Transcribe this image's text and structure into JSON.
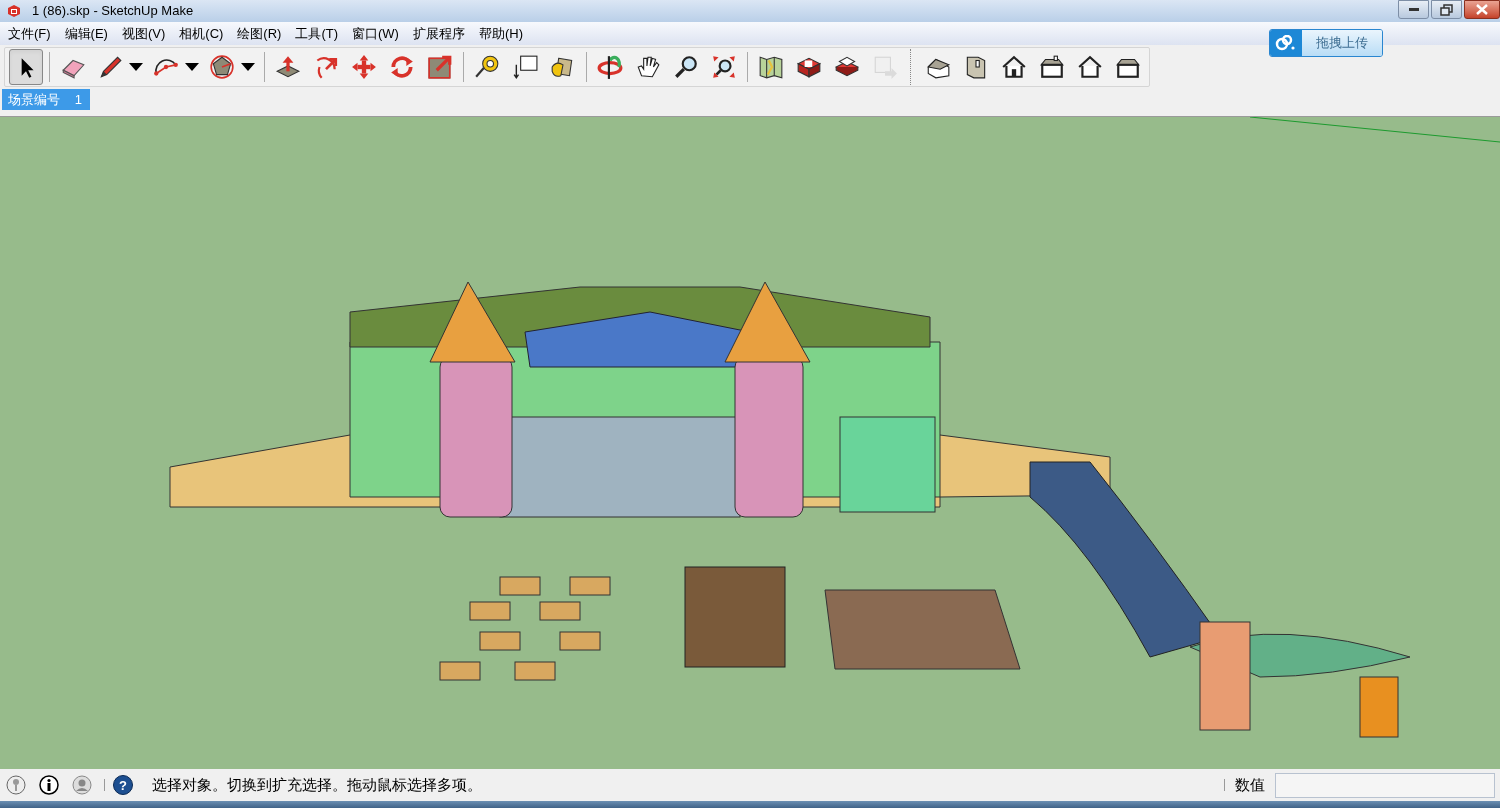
{
  "window": {
    "title": "1 (86).skp - SketchUp Make"
  },
  "window_controls": [
    {
      "kind": "minimize"
    },
    {
      "kind": "restore"
    },
    {
      "kind": "close"
    }
  ],
  "menu": [
    "文件(F)",
    "编辑(E)",
    "视图(V)",
    "相机(C)",
    "绘图(R)",
    "工具(T)",
    "窗口(W)",
    "扩展程序",
    "帮助(H)"
  ],
  "upload_widget": {
    "label": "拖拽上传"
  },
  "toolbar": [
    {
      "kind": "select",
      "selected": true,
      "disabled": false,
      "dropdown": false
    },
    {
      "kind": "separator"
    },
    {
      "kind": "eraser",
      "selected": false,
      "disabled": false,
      "dropdown": false
    },
    {
      "kind": "pencil",
      "selected": false,
      "disabled": false,
      "dropdown": true
    },
    {
      "kind": "arc",
      "selected": false,
      "disabled": false,
      "dropdown": true
    },
    {
      "kind": "polygon",
      "selected": false,
      "disabled": false,
      "dropdown": true
    },
    {
      "kind": "separator"
    },
    {
      "kind": "pushpull",
      "selected": false,
      "disabled": false,
      "dropdown": false
    },
    {
      "kind": "followme",
      "selected": false,
      "disabled": false,
      "dropdown": false
    },
    {
      "kind": "move",
      "selected": false,
      "disabled": false,
      "dropdown": false
    },
    {
      "kind": "rotate",
      "selected": false,
      "disabled": false,
      "dropdown": false
    },
    {
      "kind": "scale",
      "selected": false,
      "disabled": false,
      "dropdown": false
    },
    {
      "kind": "separator"
    },
    {
      "kind": "tape",
      "selected": false,
      "disabled": false,
      "dropdown": false
    },
    {
      "kind": "text",
      "selected": false,
      "disabled": false,
      "dropdown": false
    },
    {
      "kind": "paint",
      "selected": false,
      "disabled": false,
      "dropdown": false
    },
    {
      "kind": "separator"
    },
    {
      "kind": "orbit",
      "selected": false,
      "disabled": false,
      "dropdown": false
    },
    {
      "kind": "pan",
      "selected": false,
      "disabled": false,
      "dropdown": false
    },
    {
      "kind": "zoom",
      "selected": false,
      "disabled": false,
      "dropdown": false
    },
    {
      "kind": "extents",
      "selected": false,
      "disabled": false,
      "dropdown": false
    },
    {
      "kind": "separator"
    },
    {
      "kind": "map",
      "selected": false,
      "disabled": false,
      "dropdown": false
    },
    {
      "kind": "get",
      "selected": false,
      "disabled": false,
      "dropdown": false
    },
    {
      "kind": "share",
      "selected": false,
      "disabled": false,
      "dropdown": false
    },
    {
      "kind": "export",
      "selected": false,
      "disabled": true,
      "dropdown": false
    },
    {
      "kind": "bigseparator"
    },
    {
      "kind": "iso",
      "selected": false,
      "disabled": false,
      "dropdown": false
    },
    {
      "kind": "topview",
      "selected": false,
      "disabled": false,
      "dropdown": false
    },
    {
      "kind": "front",
      "selected": false,
      "disabled": false,
      "dropdown": false
    },
    {
      "kind": "right",
      "selected": false,
      "disabled": false,
      "dropdown": false
    },
    {
      "kind": "back",
      "selected": false,
      "disabled": false,
      "dropdown": false
    },
    {
      "kind": "left",
      "selected": false,
      "disabled": false,
      "dropdown": false
    }
  ],
  "scene_tabs": [
    {
      "label": "场景编号",
      "number": "1",
      "selected": true
    }
  ],
  "status_bar": {
    "icons": [
      {
        "kind": "geo"
      },
      {
        "kind": "info"
      },
      {
        "kind": "user"
      }
    ],
    "help": "?",
    "message": "选择对象。切换到扩充选择。拖动鼠标选择多项。",
    "measurements_label": "数值"
  }
}
